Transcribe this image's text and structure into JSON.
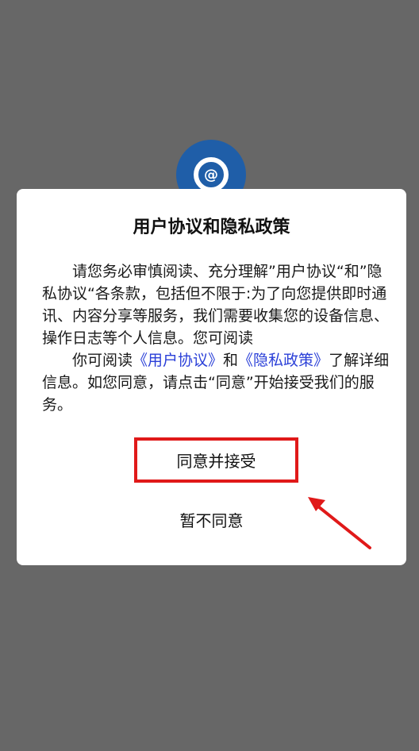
{
  "dialog": {
    "title": "用户协议和隐私政策",
    "para1": "请您务必审慎阅读、充分理解”用户协议“和”隐私协议“各条款，包括但不限于:为了向您提供即时通讯、内容分享等服务，我们需要收集您的设备信息、操作日志等个人信息。您可阅读",
    "para2_prefix": "你可阅读",
    "user_agreement_link": "《用户协议》",
    "and_text": "和",
    "privacy_link": "《隐私政策》",
    "para2_suffix": "了解详细信息。如您同意，请点击“同意”开始接受我们的服务。",
    "agree_button": "同意并接受",
    "decline_button": "暂不同意"
  },
  "colors": {
    "overlay": "#676767",
    "link": "#2a3fd8",
    "highlight_box": "#e01919",
    "logo": "#1f5ea8"
  },
  "icons": {
    "app_logo": "at-sign-logo-icon",
    "annotation_arrow": "red-arrow-icon"
  }
}
